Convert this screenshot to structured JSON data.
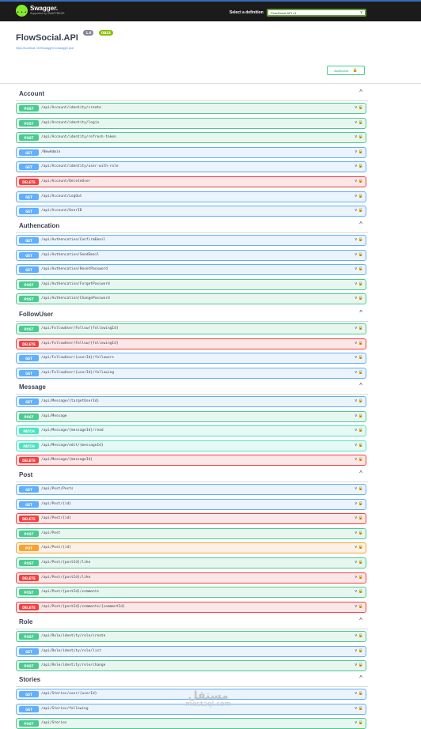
{
  "topbar": {
    "logo_symbol": "{...}",
    "logo_name": "Swagger.",
    "logo_sub": "Supported by SMARTBEAR",
    "definition_label": "Select a definition",
    "definition_value": "FlowSocial.API v1"
  },
  "info": {
    "title": "FlowSocial.API",
    "version": "1.0",
    "oas": "OAS3",
    "url": "https://localhost:7249/swagger/v1/swagger.json"
  },
  "authorize_label": "Authorize",
  "icons": {
    "chevron_up": "^",
    "chevron_down": "v",
    "lock": "🔒"
  },
  "colors": {
    "get": "#61affe",
    "post": "#49cc90",
    "delete": "#f93e3e",
    "put": "#fca130",
    "patch": "#50e3c2"
  },
  "tags": [
    {
      "name": "Account",
      "ops": [
        {
          "method": "POST",
          "path": "/api/Account/identity/create"
        },
        {
          "method": "POST",
          "path": "/api/Account/identity/login"
        },
        {
          "method": "POST",
          "path": "/api/Account/identity/refresh-token"
        },
        {
          "method": "GET",
          "path": "/NewAdmin"
        },
        {
          "method": "GET",
          "path": "/api/Account/identity/user-with-role"
        },
        {
          "method": "DELETE",
          "path": "/api/Account/DeleteUser"
        },
        {
          "method": "GET",
          "path": "/api/Account/LogOut"
        },
        {
          "method": "GET",
          "path": "/api/Account/UserID"
        }
      ]
    },
    {
      "name": "Authencation",
      "ops": [
        {
          "method": "GET",
          "path": "/api/Authencation/ConfirmEmail"
        },
        {
          "method": "GET",
          "path": "/api/Authencation/SendEmail"
        },
        {
          "method": "GET",
          "path": "/api/Authencation/ResetPassword"
        },
        {
          "method": "POST",
          "path": "/api/Authencation/ForgetPassword"
        },
        {
          "method": "POST",
          "path": "/api/Authencation/ChangePassword"
        }
      ]
    },
    {
      "name": "FollowUser",
      "ops": [
        {
          "method": "POST",
          "path": "/api/FollowUser/Follow/{followingId}"
        },
        {
          "method": "DELETE",
          "path": "/api/FollowUser/Follow/{followingId}"
        },
        {
          "method": "GET",
          "path": "/api/FollowUser/{userId}/followers"
        },
        {
          "method": "GET",
          "path": "/api/FollowUser/{userId}/following"
        }
      ]
    },
    {
      "name": "Message",
      "ops": [
        {
          "method": "GET",
          "path": "/api/Message/{targetUserId}"
        },
        {
          "method": "POST",
          "path": "/api/Message"
        },
        {
          "method": "PATCH",
          "path": "/api/Message/{messageId}/read"
        },
        {
          "method": "PATCH",
          "path": "/api/Message/edit/{messageId}"
        },
        {
          "method": "DELETE",
          "path": "/api/Message/{messageId}"
        }
      ]
    },
    {
      "name": "Post",
      "ops": [
        {
          "method": "GET",
          "path": "/api/Post/Posts"
        },
        {
          "method": "GET",
          "path": "/api/Post/{id}"
        },
        {
          "method": "DELETE",
          "path": "/api/Post/{id}"
        },
        {
          "method": "POST",
          "path": "/api/Post"
        },
        {
          "method": "PUT",
          "path": "/api/Post/{id}"
        },
        {
          "method": "POST",
          "path": "/api/Post/{postId}/like"
        },
        {
          "method": "DELETE",
          "path": "/api/Post/{postId}/like"
        },
        {
          "method": "POST",
          "path": "/api/Post/{postId}/comments"
        },
        {
          "method": "DELETE",
          "path": "/api/Post/{postId}/comments/{commentId}"
        }
      ]
    },
    {
      "name": "Role",
      "ops": [
        {
          "method": "POST",
          "path": "/api/Role/identity/role/create"
        },
        {
          "method": "GET",
          "path": "/api/Role/identity/role/list"
        },
        {
          "method": "POST",
          "path": "/api/Role/identity/role/change"
        }
      ]
    },
    {
      "name": "Stories",
      "ops": [
        {
          "method": "GET",
          "path": "/api/Stories/user/{userId}"
        },
        {
          "method": "GET",
          "path": "/api/Stories/following"
        },
        {
          "method": "POST",
          "path": "/api/Stories"
        }
      ]
    }
  ],
  "watermark": {
    "arabic": "مستقل",
    "latin": "mostaql.com"
  }
}
